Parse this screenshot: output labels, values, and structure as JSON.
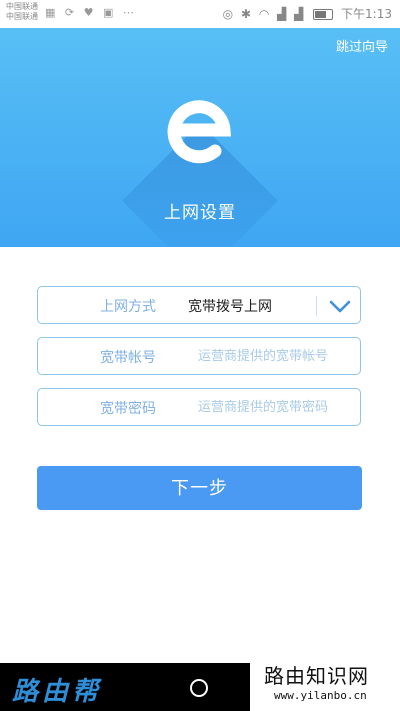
{
  "status_bar": {
    "carrier_1": "中国联通",
    "carrier_2": "中国联通",
    "notification_icons": "▦ ⟳ ♥ ▣ ⋯",
    "signal_icons": "◎ ✱ ◠ ▟ ▟",
    "time": "下午1:13",
    "battery_level": 0.7
  },
  "header": {
    "skip_label": "跳过向导",
    "title": "上网设置",
    "logo_icon": "e-logo"
  },
  "form": {
    "connection_type": {
      "label": "上网方式",
      "value": "宽带拨号上网",
      "icon": "chevron-down-icon"
    },
    "account": {
      "label": "宽带帐号",
      "placeholder": "运营商提供的宽带帐号",
      "value": ""
    },
    "password": {
      "label": "宽带密码",
      "placeholder": "运营商提供的宽带密码",
      "value": ""
    }
  },
  "actions": {
    "next_label": "下一步"
  },
  "watermark": {
    "left_text": "路由帮",
    "right_title": "路由知识网",
    "right_url": "www.yilanbo.cn"
  },
  "colors": {
    "header_top": "#58bff5",
    "header_bottom": "#3fa6f3",
    "field_border": "#8fc6ee",
    "label_text": "#7fb0e0",
    "button": "#4a99f2"
  }
}
